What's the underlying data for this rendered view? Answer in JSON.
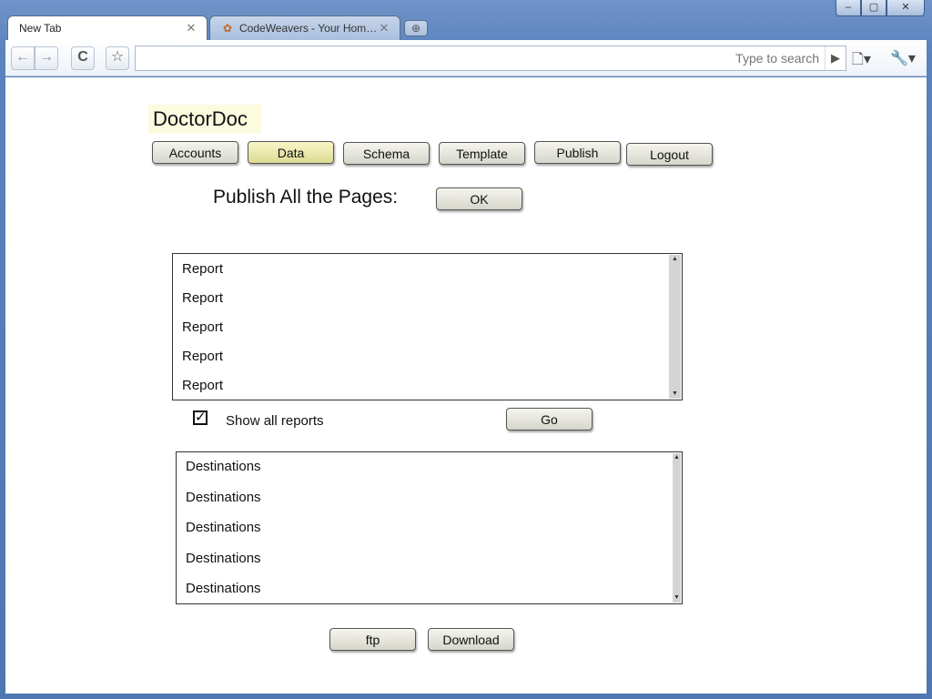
{
  "browser": {
    "tabs": [
      {
        "label": "New Tab",
        "active": true
      },
      {
        "label": "CodeWeavers - Your Home...",
        "active": false
      }
    ],
    "new_tab_icon": "plus-icon",
    "window_controls": {
      "minimize": "–",
      "maximize": "▢",
      "close": "✕"
    },
    "nav": {
      "back": "←",
      "forward": "→",
      "reload": "C",
      "star": "☆"
    },
    "omnibox": {
      "placeholder": "Type to search",
      "value": ""
    },
    "menus": {
      "page": "🗋▾",
      "wrench": "🔧▾"
    }
  },
  "app": {
    "logo": "DoctorDoc",
    "nav_tabs": [
      {
        "label": "Accounts",
        "active": false
      },
      {
        "label": "Data",
        "active": true
      },
      {
        "label": "Schema",
        "active": false
      },
      {
        "label": "Template",
        "active": false
      },
      {
        "label": "Publish",
        "active": false
      },
      {
        "label": "Logout",
        "active": false
      }
    ],
    "publish_label": "Publish All the Pages:",
    "ok_label": "OK",
    "reports": [
      "Report",
      "Report",
      "Report",
      "Report",
      "Report"
    ],
    "show_all_reports": {
      "label": "Show all reports",
      "checked": true
    },
    "go_label": "Go",
    "destinations": [
      "Destinations",
      "Destinations",
      "Destinations",
      "Destinations",
      "Destinations"
    ],
    "ftp_label": "ftp",
    "download_label": "Download"
  }
}
